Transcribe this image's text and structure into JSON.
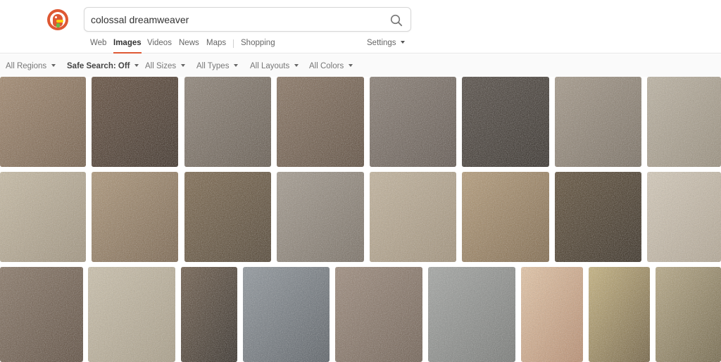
{
  "search": {
    "query": "colossal dreamweaver"
  },
  "tabs": [
    {
      "label": "Web",
      "active": false
    },
    {
      "label": "Images",
      "active": true
    },
    {
      "label": "Videos",
      "active": false
    },
    {
      "label": "News",
      "active": false
    },
    {
      "label": "Maps",
      "active": false
    },
    {
      "label": "Shopping",
      "active": false
    }
  ],
  "settings_label": "Settings",
  "filters": {
    "regions": "All Regions",
    "safe_search": "Safe Search: Off",
    "sizes": "All Sizes",
    "types": "All Types",
    "layouts": "All Layouts",
    "colors": "All Colors"
  },
  "colors": {
    "brand": "#de5833",
    "duck_beak": "#fdd20a",
    "duck_tie": "#65bc46"
  },
  "icons": {
    "logo": "duckduckgo-logo",
    "search": "search-icon",
    "dropdown": "chevron-down-icon"
  },
  "images": [
    {
      "desc": "light brown carpet swatch",
      "tone": [
        "#a08468",
        "#6f5842"
      ]
    },
    {
      "desc": "dark brown carpet swatch",
      "tone": [
        "#5e4735",
        "#34271d"
      ]
    },
    {
      "desc": "grey brown carpet swatch",
      "tone": [
        "#8b7f72",
        "#5f5448"
      ]
    },
    {
      "desc": "mocha carpet swatch",
      "tone": [
        "#86705c",
        "#584636"
      ]
    },
    {
      "desc": "grey speckled carpet swatch",
      "tone": [
        "#867a6f",
        "#5b5048"
      ]
    },
    {
      "desc": "charcoal carpet swatch",
      "tone": [
        "#4e453d",
        "#2c2620"
      ]
    },
    {
      "desc": "beige grey carpet swatch",
      "tone": [
        "#a49786",
        "#756a5c"
      ]
    },
    {
      "desc": "cream carpet swatch",
      "tone": [
        "#bdb3a1",
        "#978c79"
      ]
    },
    {
      "desc": "light beige carpet swatch",
      "tone": [
        "#c9bca3",
        "#9f917a"
      ]
    },
    {
      "desc": "tan carpet swatch",
      "tone": [
        "#ad9474",
        "#765f46"
      ]
    },
    {
      "desc": "dark tan carpet swatch",
      "tone": [
        "#7a6448",
        "#4a3c2a"
      ]
    },
    {
      "desc": "greige carpet swatch",
      "tone": [
        "#a49a8d",
        "#746a5e"
      ]
    },
    {
      "desc": "sand carpet swatch",
      "tone": [
        "#c4b49b",
        "#a08f76"
      ]
    },
    {
      "desc": "caramel carpet swatch",
      "tone": [
        "#b59a75",
        "#7d6444"
      ]
    },
    {
      "desc": "espresso carpet swatch",
      "tone": [
        "#5c4a32",
        "#2e2418"
      ]
    },
    {
      "desc": "ivory carpet swatch",
      "tone": [
        "#d7ccba",
        "#b3a692"
      ]
    },
    {
      "desc": "mushroom carpet swatch",
      "tone": [
        "#857260",
        "#574536"
      ]
    },
    {
      "desc": "light cream carpet swatch",
      "tone": [
        "#cdc2ab",
        "#a99d85"
      ]
    },
    {
      "desc": "carpet sample board display",
      "tone": [
        "#6a5744",
        "#2b241d"
      ]
    },
    {
      "desc": "blue grey carpet swatch",
      "tone": [
        "#8e959b",
        "#545a60"
      ]
    },
    {
      "desc": "taupe carpet swatch",
      "tone": [
        "#9c8878",
        "#6b5a4c"
      ]
    },
    {
      "desc": "grey berber carpet swatch",
      "tone": [
        "#a3a5a2",
        "#737572"
      ]
    },
    {
      "desc": "anime character artwork",
      "tone": [
        "#e8c7a5",
        "#b98a6a"
      ]
    },
    {
      "desc": "anime mech girl artwork",
      "tone": [
        "#c8b37a",
        "#6e5c3a"
      ]
    },
    {
      "desc": "anime green haired girl artwork",
      "tone": [
        "#b8a882",
        "#6f6242"
      ]
    }
  ]
}
